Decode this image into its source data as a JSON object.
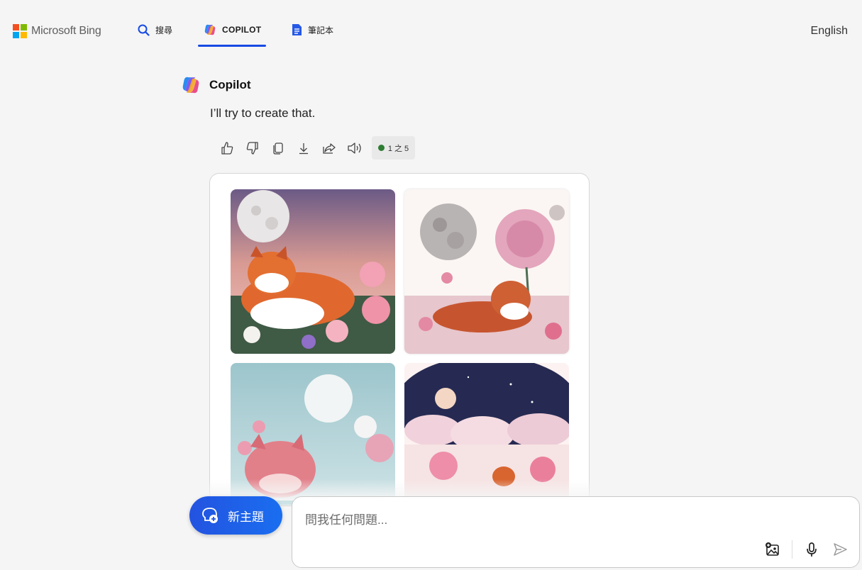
{
  "header": {
    "logo_text": "Microsoft Bing",
    "tabs": [
      {
        "label": "搜尋",
        "icon": "search-icon"
      },
      {
        "label": "COPILOT",
        "icon": "copilot-icon",
        "active": true
      },
      {
        "label": "筆記本",
        "icon": "notebook-icon"
      }
    ],
    "language": "English"
  },
  "conversation": {
    "assistant_name": "Copilot",
    "message": "I’ll try to create that.",
    "actions": [
      "like-icon",
      "dislike-icon",
      "copy-icon",
      "download-icon",
      "share-icon",
      "speaker-icon"
    ],
    "counter": "1 之 5",
    "counter_color": "#2e7d32"
  },
  "composer": {
    "new_topic_label": "新主題",
    "placeholder": "問我任何問題...",
    "icons": [
      "image-upload-icon",
      "microphone-icon",
      "send-icon"
    ]
  },
  "colors": {
    "accent": "#174ae4",
    "new_topic_bg": "#2353e0"
  }
}
